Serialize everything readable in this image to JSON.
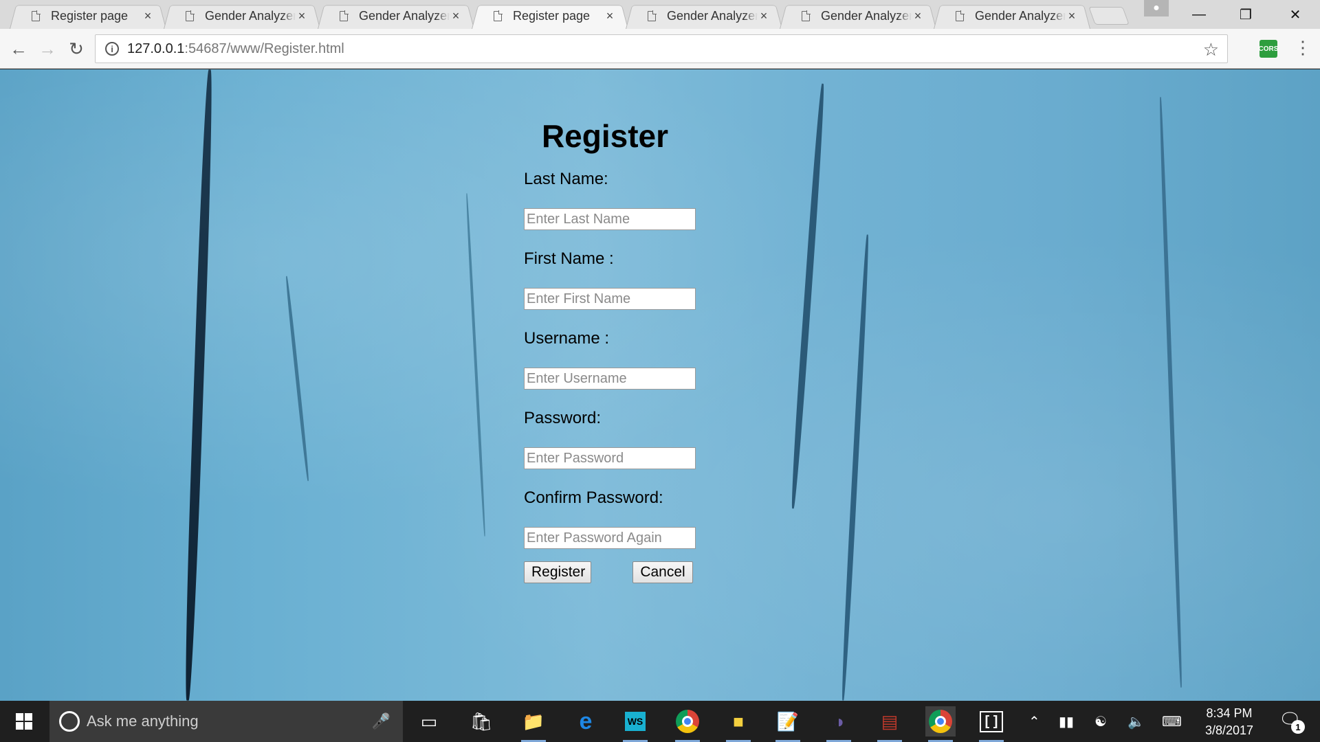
{
  "browser": {
    "tabs": [
      {
        "title": "Register page",
        "active": false
      },
      {
        "title": "Gender Analyzer",
        "active": false
      },
      {
        "title": "Gender Analyzer",
        "active": false
      },
      {
        "title": "Register page",
        "active": true
      },
      {
        "title": "Gender Analyzer",
        "active": false
      },
      {
        "title": "Gender Analyzer",
        "active": false
      },
      {
        "title": "Gender Analyzer",
        "active": false
      }
    ],
    "tab_close_glyph": "×",
    "url_host": "127.0.0.1",
    "url_rest": ":54687/www/Register.html",
    "extension_label": "CORS"
  },
  "form": {
    "title": "Register",
    "fields": [
      {
        "label": "Last Name:",
        "placeholder": "Enter Last Name"
      },
      {
        "label": "First Name :",
        "placeholder": "Enter First Name"
      },
      {
        "label": "Username :",
        "placeholder": "Enter Username"
      },
      {
        "label": "Password:",
        "placeholder": "Enter Password"
      },
      {
        "label": "Confirm Password:",
        "placeholder": "Enter Password Again"
      }
    ],
    "register_label": "Register",
    "cancel_label": "Cancel"
  },
  "taskbar": {
    "search_placeholder": "Ask me anything",
    "time": "8:34 PM",
    "date": "3/8/2017",
    "notification_count": "1",
    "app_icons": [
      "task-view-icon",
      "store-icon",
      "file-explorer-icon",
      "edge-icon",
      "webstorm-icon",
      "chrome-icon",
      "sticky-notes-icon",
      "notepad-icon",
      "eclipse-icon",
      "winrar-icon",
      "chrome-icon",
      "brackets-icon"
    ]
  },
  "colors": {
    "background_wood": "#6aaed1",
    "taskbar": "#1f1f1f",
    "cors_badge": "#2e9e3e"
  }
}
